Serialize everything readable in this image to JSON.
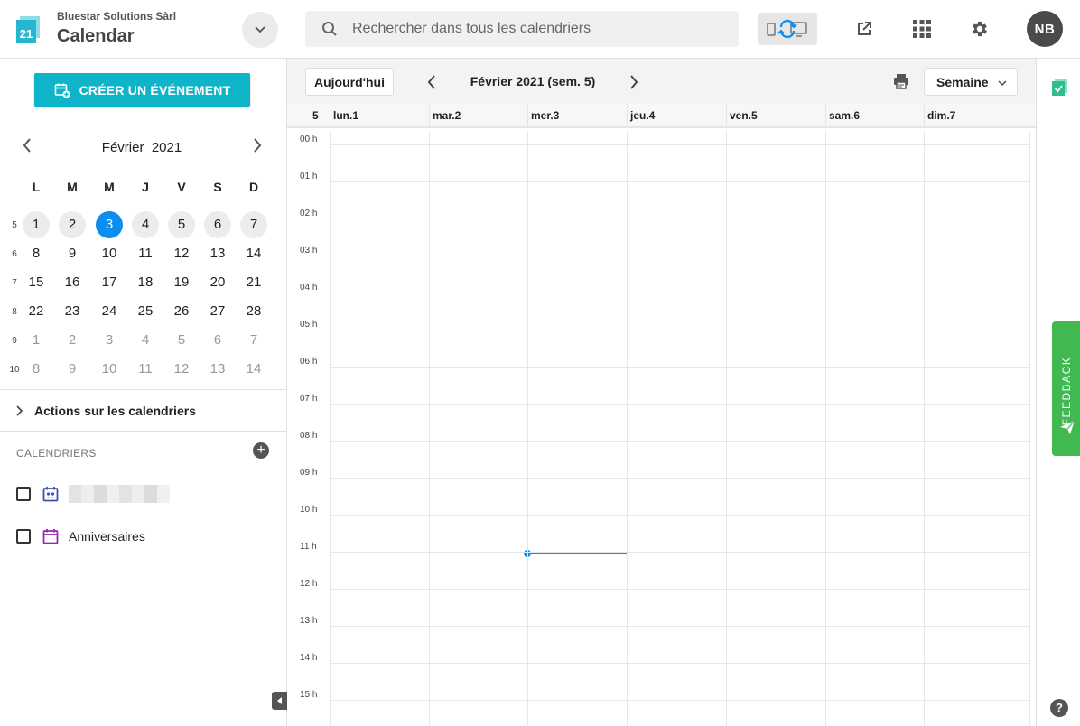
{
  "header": {
    "org_name": "Bluestar Solutions Sàrl",
    "app_name": "Calendar",
    "logo_number": "21",
    "search_placeholder": "Rechercher dans tous les calendriers",
    "avatar_initials": "NB",
    "icons": [
      "app-switcher-chevron-icon",
      "search-icon",
      "sync-devices-icon",
      "external-link-icon",
      "apps-grid-icon",
      "gear-icon"
    ]
  },
  "sidebar": {
    "create_label": "CRÉER UN ÉVÉNEMENT",
    "mini_calendar": {
      "month": "Février",
      "year": "2021",
      "weekdays": [
        "L",
        "M",
        "M",
        "J",
        "V",
        "S",
        "D"
      ],
      "weeks": [
        {
          "num": "5",
          "days": [
            "1",
            "2",
            "3",
            "4",
            "5",
            "6",
            "7"
          ],
          "other": false
        },
        {
          "num": "6",
          "days": [
            "8",
            "9",
            "10",
            "11",
            "12",
            "13",
            "14"
          ],
          "other": false
        },
        {
          "num": "7",
          "days": [
            "15",
            "16",
            "17",
            "18",
            "19",
            "20",
            "21"
          ],
          "other": false
        },
        {
          "num": "8",
          "days": [
            "22",
            "23",
            "24",
            "25",
            "26",
            "27",
            "28"
          ],
          "other": false
        },
        {
          "num": "9",
          "days": [
            "1",
            "2",
            "3",
            "4",
            "5",
            "6",
            "7"
          ],
          "other": true
        },
        {
          "num": "10",
          "days": [
            "8",
            "9",
            "10",
            "11",
            "12",
            "13",
            "14"
          ],
          "other": true
        }
      ],
      "selected_day": "3"
    },
    "actions_label": "Actions sur les calendriers",
    "calendars_heading": "CALENDRIERS",
    "calendars": [
      {
        "name": "",
        "icon": "calendar-people-icon",
        "color": "#3f51b5",
        "checked": false
      },
      {
        "name": "Anniversaires",
        "icon": "calendar-icon",
        "color": "#9c27b0",
        "checked": false
      }
    ]
  },
  "main": {
    "today_label": "Aujourd'hui",
    "period_label": "Février 2021 (sem. 5)",
    "view_label": "Semaine",
    "week_number": "5",
    "days": [
      "lun.1",
      "mar.2",
      "mer.3",
      "jeu.4",
      "ven.5",
      "sam.6",
      "dim.7"
    ],
    "hours": [
      "00 h",
      "01 h",
      "02 h",
      "03 h",
      "04 h",
      "05 h",
      "06 h",
      "07 h",
      "08 h",
      "09 h",
      "10 h",
      "11 h",
      "12 h",
      "13 h",
      "14 h",
      "15 h"
    ],
    "accent_color": "#0b8ef0"
  },
  "rail": {
    "feedback_label": "FEEDBACK",
    "help_label": "?"
  }
}
